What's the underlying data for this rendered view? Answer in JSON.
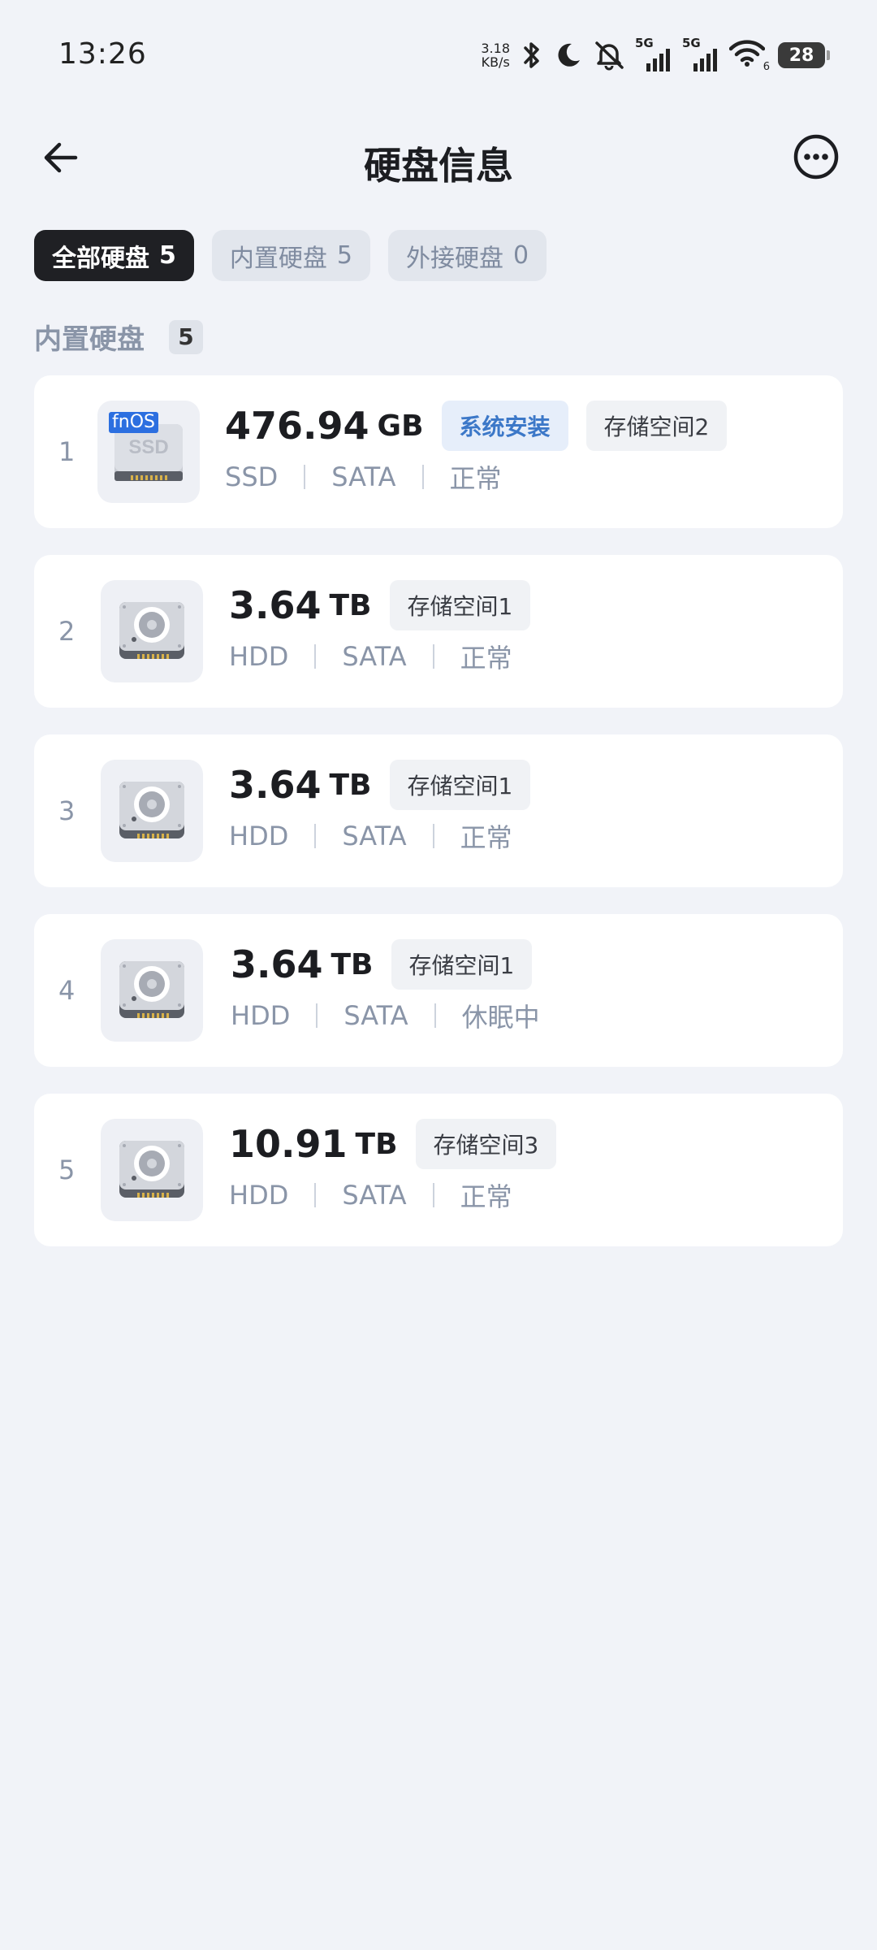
{
  "status_bar": {
    "time": "13:26",
    "net_speed_value": "3.18",
    "net_speed_unit": "KB/s",
    "signal_1_label": "5G",
    "signal_2_label": "5G",
    "wifi_label": "6",
    "battery_level": "28"
  },
  "header": {
    "title": "硬盘信息",
    "back_icon": "arrow-left-icon",
    "more_icon": "more-horizontal-circle-icon"
  },
  "tabs": [
    {
      "label": "全部硬盘",
      "count": "5",
      "active": true
    },
    {
      "label": "内置硬盘",
      "count": "5",
      "active": false
    },
    {
      "label": "外接硬盘",
      "count": "0",
      "active": false
    }
  ],
  "section": {
    "title": "内置硬盘",
    "count": "5"
  },
  "disks": [
    {
      "index": "1",
      "capacity": "476.94",
      "unit": "GB",
      "icon": "ssd-icon",
      "icon_tag": "fnOS",
      "system_badge": "系统安装",
      "pool": "存储空间2",
      "type": "SSD",
      "interface": "SATA",
      "status": "正常"
    },
    {
      "index": "2",
      "capacity": "3.64",
      "unit": "TB",
      "icon": "hdd-icon",
      "pool": "存储空间1",
      "type": "HDD",
      "interface": "SATA",
      "status": "正常"
    },
    {
      "index": "3",
      "capacity": "3.64",
      "unit": "TB",
      "icon": "hdd-icon",
      "pool": "存储空间1",
      "type": "HDD",
      "interface": "SATA",
      "status": "正常"
    },
    {
      "index": "4",
      "capacity": "3.64",
      "unit": "TB",
      "icon": "hdd-icon",
      "pool": "存储空间1",
      "type": "HDD",
      "interface": "SATA",
      "status": "休眠中"
    },
    {
      "index": "5",
      "capacity": "10.91",
      "unit": "TB",
      "icon": "hdd-icon",
      "pool": "存储空间3",
      "type": "HDD",
      "interface": "SATA",
      "status": "正常"
    }
  ],
  "colors": {
    "background": "#f1f3f8",
    "card": "#ffffff",
    "active_tab": "#1f2024",
    "system_badge_text": "#3c78c8",
    "muted_text": "#8a95a8"
  }
}
